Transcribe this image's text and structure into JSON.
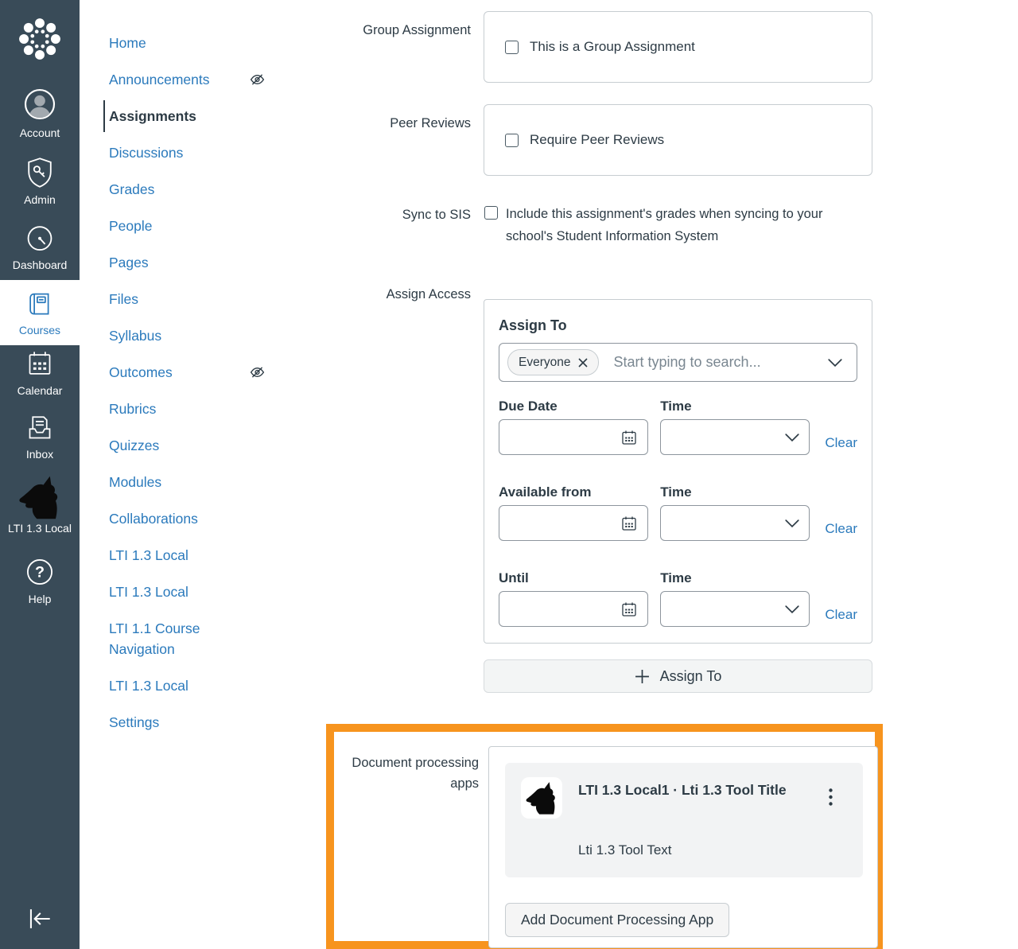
{
  "colors": {
    "sidebar_bg": "#394B58",
    "link_blue": "#2B7ABC",
    "ink": "#2D3B45",
    "border": "#C7CDD1",
    "highlight_orange": "#F7941E"
  },
  "sidebar": {
    "items": [
      {
        "label": "Account"
      },
      {
        "label": "Admin"
      },
      {
        "label": "Dashboard"
      },
      {
        "label": "Courses",
        "active": true
      },
      {
        "label": "Calendar"
      },
      {
        "label": "Inbox"
      },
      {
        "label": "LTI 1.3 Local"
      },
      {
        "label": "Help"
      }
    ]
  },
  "course_nav": {
    "items": [
      {
        "label": "Home"
      },
      {
        "label": "Announcements",
        "hidden": true
      },
      {
        "label": "Assignments",
        "active": true
      },
      {
        "label": "Discussions"
      },
      {
        "label": "Grades"
      },
      {
        "label": "People"
      },
      {
        "label": "Pages"
      },
      {
        "label": "Files"
      },
      {
        "label": "Syllabus"
      },
      {
        "label": "Outcomes",
        "hidden": true
      },
      {
        "label": "Rubrics"
      },
      {
        "label": "Quizzes"
      },
      {
        "label": "Modules"
      },
      {
        "label": "Collaborations"
      },
      {
        "label": "LTI 1.3 Local"
      },
      {
        "label": "LTI 1.3 Local"
      },
      {
        "label": "LTI 1.1 Course Navigation"
      },
      {
        "label": "LTI 1.3 Local"
      },
      {
        "label": "Settings"
      }
    ]
  },
  "form": {
    "group_assignment": {
      "label": "Group Assignment",
      "checkbox_label": "This is a Group Assignment",
      "checked": false
    },
    "peer_reviews": {
      "label": "Peer Reviews",
      "checkbox_label": "Require Peer Reviews",
      "checked": false
    },
    "sync_to_sis": {
      "label": "Sync to SIS",
      "checkbox_label": "Include this assignment's grades when syncing to your school's Student Information System",
      "checked": false
    },
    "assign_access": {
      "label": "Assign Access",
      "heading": "Assign To",
      "selected_tag": "Everyone",
      "search_placeholder": "Start typing to search...",
      "rows": [
        {
          "date_label": "Due Date",
          "date_value": "",
          "time_label": "Time",
          "time_value": "",
          "clear_label": "Clear"
        },
        {
          "date_label": "Available from",
          "date_value": "",
          "time_label": "Time",
          "time_value": "",
          "clear_label": "Clear"
        },
        {
          "date_label": "Until",
          "date_value": "",
          "time_label": "Time",
          "time_value": "",
          "clear_label": "Clear"
        }
      ],
      "add_button_label": "Assign To"
    },
    "document_processing": {
      "label": "Document processing apps",
      "card": {
        "title": "LTI 1.3 Local1 · Lti 1.3 Tool Title",
        "subtitle": "Lti 1.3 Tool Text"
      },
      "add_button_label": "Add Document Processing App"
    }
  }
}
